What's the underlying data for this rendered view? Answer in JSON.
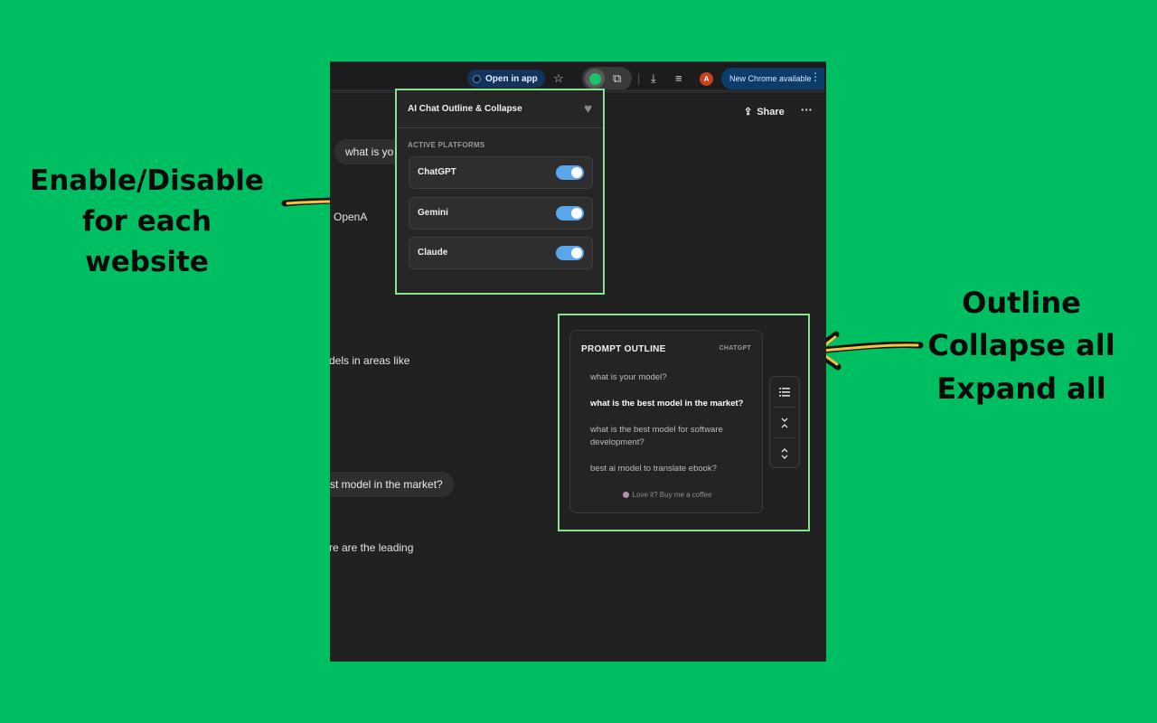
{
  "annotations": {
    "left": "Enable/Disable for each website",
    "right": "Outline Collapse all Expand all"
  },
  "browser": {
    "open_in_app": "Open in app",
    "avatar_letter": "A",
    "new_chrome": "New Chrome available"
  },
  "chat": {
    "share": "Share",
    "fragments": [
      "what is yo",
      "OpenA",
      "dels in areas like",
      "st model in the market?",
      "re are the leading"
    ]
  },
  "popup": {
    "title": "AI Chat Outline & Collapse",
    "section": "ACTIVE PLATFORMS",
    "platforms": [
      {
        "label": "ChatGPT",
        "enabled": true
      },
      {
        "label": "Gemini",
        "enabled": true
      },
      {
        "label": "Claude",
        "enabled": true
      }
    ]
  },
  "outline": {
    "title": "PROMPT OUTLINE",
    "platform_tag": "CHATGPT",
    "items": [
      "what is your model?",
      "what is the best model in the market?",
      "what is the best model for software development?",
      "best ai model to translate ebook?"
    ],
    "footer": "Love it? Buy me a coffee"
  },
  "colors": {
    "background": "#00be62",
    "highlight_border": "#86e38e",
    "toggle_on": "#5aa6ea",
    "arrow_fill": "#f5c542"
  }
}
